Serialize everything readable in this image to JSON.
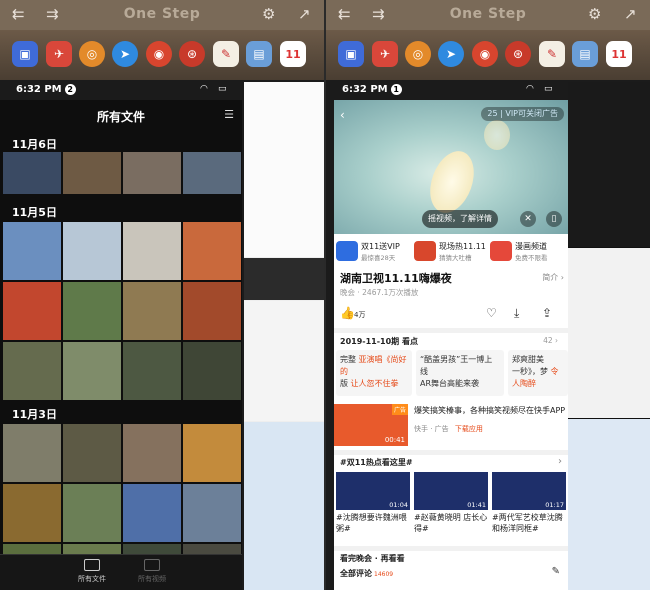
{
  "top_bar": {
    "title": "One Step",
    "back_icon": "double-left-arrow-icon",
    "forward_icon": "double-right-arrow-icon",
    "settings_icon": "gear-icon",
    "collapse_icon": "diagonal-arrow-icon"
  },
  "status_bar": {
    "left_time": "6:32 PM",
    "left_badge": "2",
    "right_time": "6:32 PM",
    "right_badge": "1"
  },
  "dock_apps": [
    "finder-icon",
    "pin-icon",
    "magnifier-icon",
    "paper-plane-icon",
    "weibo-icon",
    "sina-weibo-icon",
    "notes-icon",
    "preview-icon",
    "calendar-icon"
  ],
  "calendar_day": "11",
  "photos": {
    "title": "所有文件",
    "dates": [
      "11月6日",
      "11月5日",
      "11月3日"
    ],
    "tab_all": "所有文件",
    "tab_all_videos": "所有视频",
    "colors": {
      "row1": [
        "#3a4a63",
        "#6e5a44",
        "#7a6d61",
        "#5a6a7d"
      ],
      "row2": [
        "#6b8fbf",
        "#b7c7d6",
        "#c9c5bb",
        "#c9693c"
      ],
      "row3": [
        "#c2472e",
        "#5f7a4a",
        "#8f7a52",
        "#a24a2b"
      ],
      "row4": [
        "#656b4e",
        "#7f8c6a",
        "#4d5842",
        "#3f4636"
      ],
      "row5": [
        "#7f7d6a",
        "#5d5a45",
        "#85715e",
        "#c38b3c"
      ],
      "row6": [
        "#8a6a30",
        "#6b7f56",
        "#4f6fa8",
        "#6c8099"
      ],
      "row7": [
        "#5b6e3e",
        "#6a7b4d",
        "#3f4a3a",
        "#4a4a40"
      ]
    }
  },
  "video": {
    "vip_badge": "VIP可关闭广告",
    "vip_timer": "25",
    "shake_text": "摇视频，了解详情",
    "mute_icon": "mute-icon",
    "pip_icon": "pip-icon",
    "promos": [
      {
        "title": "双11送VIP",
        "sub": "最惊喜28天",
        "color": "#2e6de0"
      },
      {
        "title": "现场热11.11",
        "sub": "猜猜大吐槽",
        "color": "#d8472c"
      },
      {
        "title": "漫画频道",
        "sub": "免费不限看",
        "color": "#e5483a"
      }
    ],
    "title": "湖南卫视11.11嗨爆夜",
    "intro_link": "简介",
    "views": "晚会 · 2467.1万次播放",
    "like_count": "4万",
    "episode_title": "2019-11-10期 看点",
    "episode_count": "42",
    "episode_cards": [
      {
        "line1": "完整",
        "line2": "版",
        "hl": "亚演唱《尚好的",
        "hl2": "让人忽不住拳"
      },
      {
        "line1": "“酷盖男孩”王一博上线",
        "line2": "AR舞台高能来袭",
        "hl": "",
        "hl2": ""
      },
      {
        "line1": "郑爽甜美",
        "line2": "一秒》，梦",
        "hl": "",
        "hl2": "令人陶醉"
      }
    ],
    "ad_text": "爆笑搞笑榛事，各种搞笑视频尽在快手APP",
    "ad_source": "快手 · 广告",
    "ad_download": "下载应用",
    "ad_tag": "广告",
    "ad_duration": "00:41",
    "hot_title": "#双11热点看这里#",
    "hot_videos": [
      {
        "caption": "#沈腾想要许魏洲喂粥#",
        "duration": "01:04"
      },
      {
        "caption": "#赵薇黄晓明 店长心得#",
        "duration": "01:41"
      },
      {
        "caption": "#两代军艺校草沈腾和杨洋同框#",
        "duration": "01:17"
      }
    ],
    "comments": "全部评论",
    "comments_count": "14609",
    "partial_header": "看完晚会 · 再看看"
  }
}
